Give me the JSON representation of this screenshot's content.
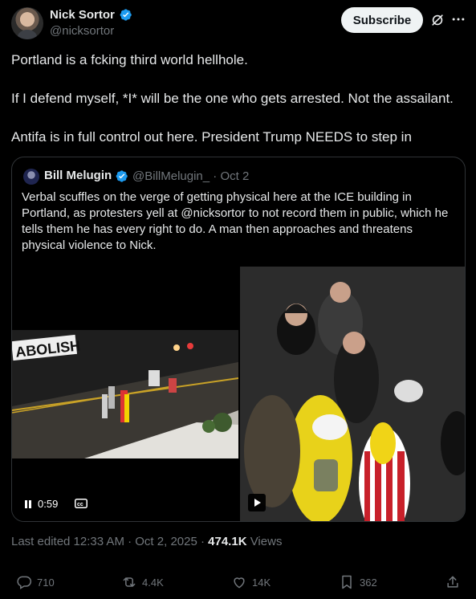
{
  "post": {
    "author_name": "Nick Sortor",
    "author_handle": "@nicksortor",
    "subscribe_label": "Subscribe",
    "paragraphs": [
      "Portland is a fcking third world hellhole.",
      "If I defend myself, *I* will be the one who gets arrested. Not the assailant.",
      "Antifa is in full control out here. President Trump NEEDS to step in"
    ]
  },
  "quote": {
    "author_name": "Bill Melugin",
    "author_handle": "@BillMelugin_",
    "date": "· Oct 2",
    "text": "Verbal scuffles on the verge of getting physical here at the ICE building in Portland, as protesters yell at @nicksortor to not record them in public, which he tells them he has every right to do. A man then approaches and threatens physical violence to Nick.",
    "video_time": "0:59",
    "sign_text": "ABOLISH"
  },
  "meta": {
    "edited": "Last edited 12:33 AM · Oct 2, 2025 · ",
    "views_count": "474.1K",
    "views_label": " Views"
  },
  "actions": {
    "replies": "710",
    "reposts": "4.4K",
    "likes": "14K",
    "bookmarks": "362"
  },
  "icons": [
    "verified-badge-icon",
    "grok-icon",
    "more-icon",
    "pause-icon",
    "cc-icon",
    "play-icon",
    "reply-icon",
    "repost-icon",
    "like-icon",
    "bookmark-icon",
    "share-icon"
  ],
  "colors": {
    "background": "#000000",
    "text": "#e7e9ea",
    "muted": "#71767b",
    "verified": "#1d9bf0",
    "border": "#2f3336"
  }
}
